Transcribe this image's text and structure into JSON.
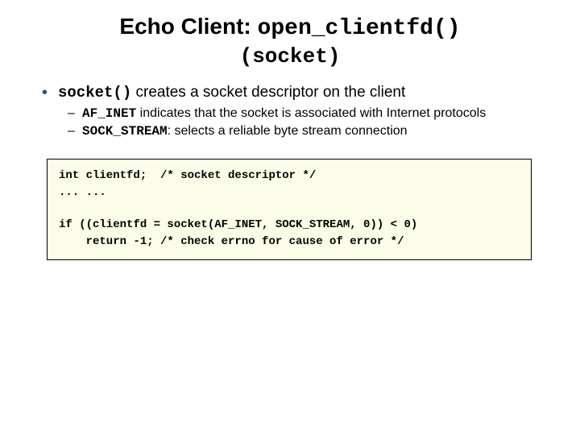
{
  "title": {
    "prefix": "Echo Client: ",
    "code": "open_clientfd()"
  },
  "subtitle": {
    "open": "(",
    "code": "socket",
    "close": ")"
  },
  "bullet": {
    "code": "socket()",
    "text": " creates a socket descriptor on the client"
  },
  "sub1": {
    "code": "AF_INET",
    "text": " indicates that the socket is associated with Internet protocols"
  },
  "sub2": {
    "code": "SOCK_STREAM",
    "text": ": selects a reliable byte stream connection"
  },
  "code": {
    "line1": "int clientfd;  /* socket descriptor */",
    "line2": "... ...",
    "line3": "",
    "line4": "if ((clientfd = socket(AF_INET, SOCK_STREAM, 0)) < 0)",
    "line5": "    return -1; /* check errno for cause of error */"
  }
}
